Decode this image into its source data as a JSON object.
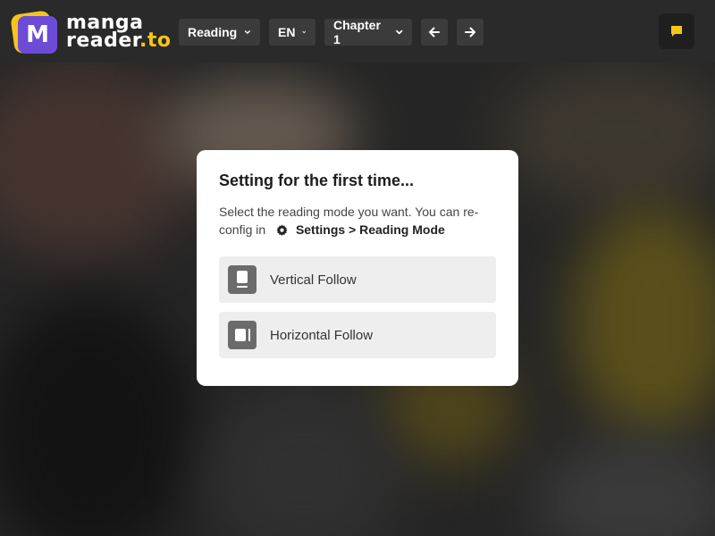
{
  "logo": {
    "mark": "M",
    "line1": "manga",
    "line2_main": "reader",
    "line2_tld": ".to"
  },
  "toolbar": {
    "reading_dropdown": "Reading",
    "language_dropdown": "EN",
    "chapter_dropdown": "Chapter 1",
    "prev_icon": "arrow-left-icon",
    "next_icon": "arrow-right-icon",
    "chat_icon": "chat-bubble-icon"
  },
  "modal": {
    "title": "Setting for the first time...",
    "description": "Select the reading mode you want. You can re-config in",
    "settings_path": "Settings > Reading Mode",
    "options": [
      {
        "label": "Vertical Follow",
        "icon": "vertical-follow-icon"
      },
      {
        "label": "Horizontal Follow",
        "icon": "horizontal-follow-icon"
      }
    ]
  },
  "colors": {
    "accent_yellow": "#f5c518",
    "logo_purple": "#6c4cd6",
    "header_bg": "#2a2a2a",
    "button_bg": "#3b3b3b"
  }
}
